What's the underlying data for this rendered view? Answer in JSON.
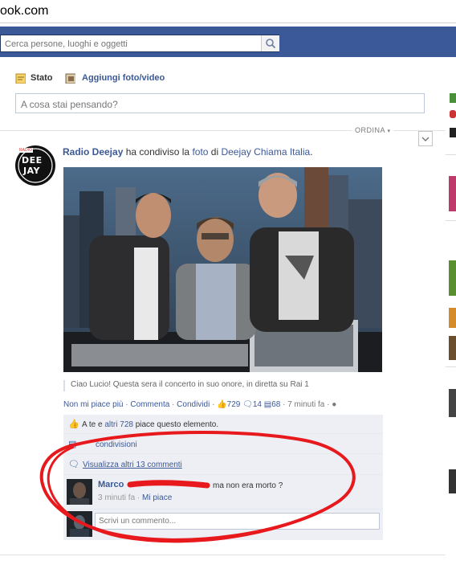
{
  "browser": {
    "url_fragment": "ook.com"
  },
  "search": {
    "placeholder": "Cerca persone, luoghi e oggetti"
  },
  "composer": {
    "tab_status": "Stato",
    "tab_photo": "Aggiungi foto/video",
    "input_placeholder": "A cosa stai pensando?"
  },
  "feed": {
    "sort_label": "ORDINA"
  },
  "post": {
    "author": "Radio Deejay",
    "action_text": " ha condiviso la ",
    "object": "foto",
    "di_text": " di ",
    "source": "Deejay Chiama Italia",
    "period": ".",
    "avatar_text_top": "DEE",
    "avatar_text_bottom": "JAY",
    "avatar_tiny": "RADIO",
    "caption": "Ciao Lucio! Questa sera il concerto in suo onore, in diretta su Rai 1",
    "actions": {
      "unlike": "Non mi piace più",
      "comment": "Commenta",
      "share": "Condividi",
      "sep": " · ",
      "likes": "729",
      "comments_count": "14",
      "shares_count": "68",
      "time": "7 minuti fa"
    }
  },
  "ufi": {
    "likes_prefix": "A te e ",
    "likes_link": "altri 728",
    "likes_suffix": " piace questo elemento.",
    "shares": "condivisioni",
    "view_more": "Visualizza altri 13 commenti",
    "comment": {
      "author": "Marco",
      "text": "ma non era morto ?",
      "time": "3 minuti fa",
      "like": "Mi piace",
      "sep": " · "
    },
    "write_placeholder": "Scrivi un commento..."
  },
  "colors": {
    "facebook_blue": "#3b5998",
    "annotation_red": "#e8191d"
  }
}
